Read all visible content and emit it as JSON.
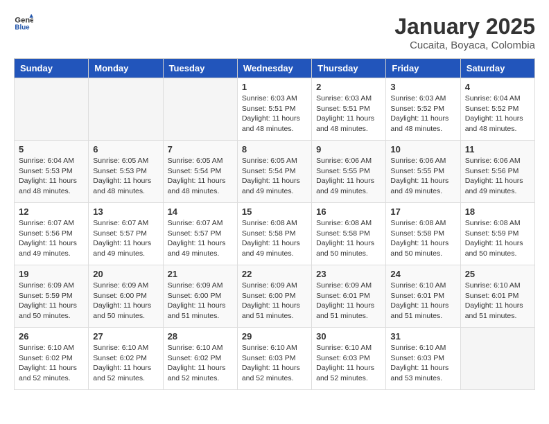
{
  "header": {
    "logo_general": "General",
    "logo_blue": "Blue",
    "title": "January 2025",
    "subtitle": "Cucaita, Boyaca, Colombia"
  },
  "calendar": {
    "days_of_week": [
      "Sunday",
      "Monday",
      "Tuesday",
      "Wednesday",
      "Thursday",
      "Friday",
      "Saturday"
    ],
    "weeks": [
      [
        {
          "day": "",
          "info": ""
        },
        {
          "day": "",
          "info": ""
        },
        {
          "day": "",
          "info": ""
        },
        {
          "day": "1",
          "info": "Sunrise: 6:03 AM\nSunset: 5:51 PM\nDaylight: 11 hours and 48 minutes."
        },
        {
          "day": "2",
          "info": "Sunrise: 6:03 AM\nSunset: 5:51 PM\nDaylight: 11 hours and 48 minutes."
        },
        {
          "day": "3",
          "info": "Sunrise: 6:03 AM\nSunset: 5:52 PM\nDaylight: 11 hours and 48 minutes."
        },
        {
          "day": "4",
          "info": "Sunrise: 6:04 AM\nSunset: 5:52 PM\nDaylight: 11 hours and 48 minutes."
        }
      ],
      [
        {
          "day": "5",
          "info": "Sunrise: 6:04 AM\nSunset: 5:53 PM\nDaylight: 11 hours and 48 minutes."
        },
        {
          "day": "6",
          "info": "Sunrise: 6:05 AM\nSunset: 5:53 PM\nDaylight: 11 hours and 48 minutes."
        },
        {
          "day": "7",
          "info": "Sunrise: 6:05 AM\nSunset: 5:54 PM\nDaylight: 11 hours and 48 minutes."
        },
        {
          "day": "8",
          "info": "Sunrise: 6:05 AM\nSunset: 5:54 PM\nDaylight: 11 hours and 49 minutes."
        },
        {
          "day": "9",
          "info": "Sunrise: 6:06 AM\nSunset: 5:55 PM\nDaylight: 11 hours and 49 minutes."
        },
        {
          "day": "10",
          "info": "Sunrise: 6:06 AM\nSunset: 5:55 PM\nDaylight: 11 hours and 49 minutes."
        },
        {
          "day": "11",
          "info": "Sunrise: 6:06 AM\nSunset: 5:56 PM\nDaylight: 11 hours and 49 minutes."
        }
      ],
      [
        {
          "day": "12",
          "info": "Sunrise: 6:07 AM\nSunset: 5:56 PM\nDaylight: 11 hours and 49 minutes."
        },
        {
          "day": "13",
          "info": "Sunrise: 6:07 AM\nSunset: 5:57 PM\nDaylight: 11 hours and 49 minutes."
        },
        {
          "day": "14",
          "info": "Sunrise: 6:07 AM\nSunset: 5:57 PM\nDaylight: 11 hours and 49 minutes."
        },
        {
          "day": "15",
          "info": "Sunrise: 6:08 AM\nSunset: 5:58 PM\nDaylight: 11 hours and 49 minutes."
        },
        {
          "day": "16",
          "info": "Sunrise: 6:08 AM\nSunset: 5:58 PM\nDaylight: 11 hours and 50 minutes."
        },
        {
          "day": "17",
          "info": "Sunrise: 6:08 AM\nSunset: 5:58 PM\nDaylight: 11 hours and 50 minutes."
        },
        {
          "day": "18",
          "info": "Sunrise: 6:08 AM\nSunset: 5:59 PM\nDaylight: 11 hours and 50 minutes."
        }
      ],
      [
        {
          "day": "19",
          "info": "Sunrise: 6:09 AM\nSunset: 5:59 PM\nDaylight: 11 hours and 50 minutes."
        },
        {
          "day": "20",
          "info": "Sunrise: 6:09 AM\nSunset: 6:00 PM\nDaylight: 11 hours and 50 minutes."
        },
        {
          "day": "21",
          "info": "Sunrise: 6:09 AM\nSunset: 6:00 PM\nDaylight: 11 hours and 51 minutes."
        },
        {
          "day": "22",
          "info": "Sunrise: 6:09 AM\nSunset: 6:00 PM\nDaylight: 11 hours and 51 minutes."
        },
        {
          "day": "23",
          "info": "Sunrise: 6:09 AM\nSunset: 6:01 PM\nDaylight: 11 hours and 51 minutes."
        },
        {
          "day": "24",
          "info": "Sunrise: 6:10 AM\nSunset: 6:01 PM\nDaylight: 11 hours and 51 minutes."
        },
        {
          "day": "25",
          "info": "Sunrise: 6:10 AM\nSunset: 6:01 PM\nDaylight: 11 hours and 51 minutes."
        }
      ],
      [
        {
          "day": "26",
          "info": "Sunrise: 6:10 AM\nSunset: 6:02 PM\nDaylight: 11 hours and 52 minutes."
        },
        {
          "day": "27",
          "info": "Sunrise: 6:10 AM\nSunset: 6:02 PM\nDaylight: 11 hours and 52 minutes."
        },
        {
          "day": "28",
          "info": "Sunrise: 6:10 AM\nSunset: 6:02 PM\nDaylight: 11 hours and 52 minutes."
        },
        {
          "day": "29",
          "info": "Sunrise: 6:10 AM\nSunset: 6:03 PM\nDaylight: 11 hours and 52 minutes."
        },
        {
          "day": "30",
          "info": "Sunrise: 6:10 AM\nSunset: 6:03 PM\nDaylight: 11 hours and 52 minutes."
        },
        {
          "day": "31",
          "info": "Sunrise: 6:10 AM\nSunset: 6:03 PM\nDaylight: 11 hours and 53 minutes."
        },
        {
          "day": "",
          "info": ""
        }
      ]
    ]
  }
}
